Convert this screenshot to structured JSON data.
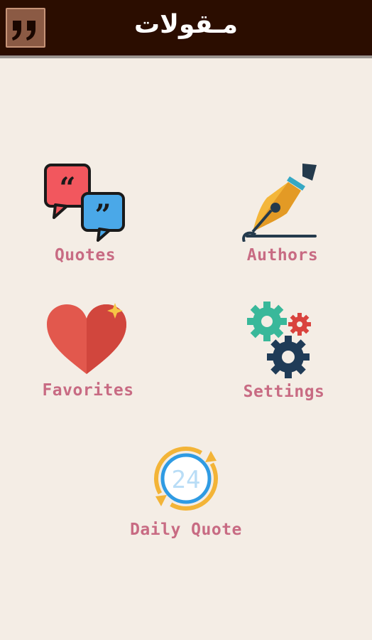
{
  "header": {
    "title": "مـقولات",
    "logo_icon": "quote-marks-icon"
  },
  "menu": {
    "quotes_label": "Quotes",
    "authors_label": "Authors",
    "favorites_label": "Favorites",
    "settings_label": "Settings",
    "daily_label": "Daily Quote",
    "daily_number": "24"
  },
  "colors": {
    "header_bg": "#2b0d00",
    "label": "#c86b83",
    "background": "#f4ede5"
  }
}
